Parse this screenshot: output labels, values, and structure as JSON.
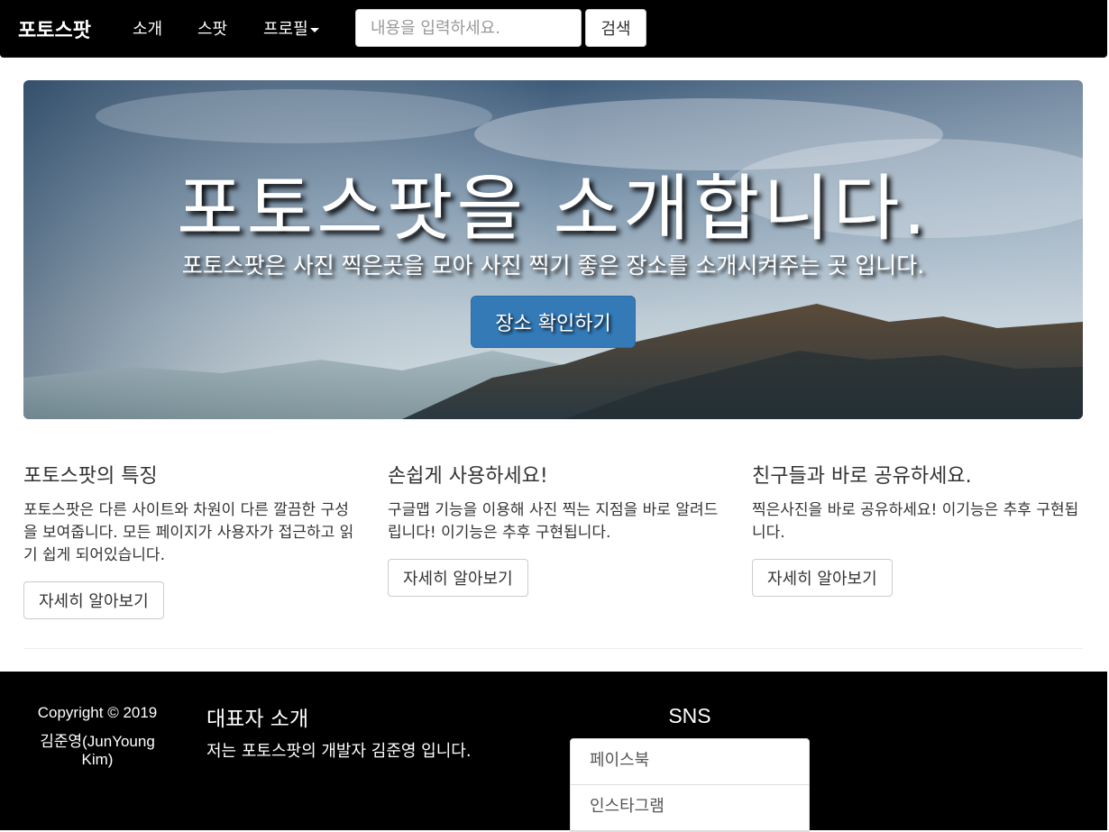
{
  "navbar": {
    "brand": "포토스팟",
    "items": [
      {
        "label": "소개"
      },
      {
        "label": "스팟"
      },
      {
        "label": "프로필"
      }
    ],
    "search": {
      "placeholder": "내용을 입력하세요.",
      "value": ""
    },
    "search_button": "검색"
  },
  "jumbotron": {
    "title": "포토스팟을 소개합니다.",
    "subtitle": "포토스팟은 사진 찍은곳을 모아 사진 찍기 좋은 장소를 소개시켜주는 곳 입니다.",
    "button": "장소 확인하기"
  },
  "features": [
    {
      "title": "포토스팟의 특징",
      "text": "포토스팟은 다른 사이트와 차원이 다른 깔끔한 구성을 보여줍니다. 모든 페이지가 사용자가 접근하고 읽기 쉽게 되어있습니다.",
      "button": "자세히 알아보기"
    },
    {
      "title": "손쉽게 사용하세요!",
      "text": "구글맵 기능을 이용해 사진 찍는 지점을 바로 알려드립니다! 이기능은 추후 구현됩니다.",
      "button": "자세히 알아보기"
    },
    {
      "title": "친구들과 바로 공유하세요.",
      "text": "찍은사진을 바로 공유하세요! 이기능은 추후 구현됩니다.",
      "button": "자세히 알아보기"
    }
  ],
  "footer": {
    "copyright": "Copyright © 2019",
    "author": "김준영(JunYoung Kim)",
    "rep_title": "대표자 소개",
    "rep_text": "저는 포토스팟의 개발자 김준영 입니다.",
    "sns_title": "SNS",
    "sns_items": [
      {
        "label": "페이스북"
      },
      {
        "label": "인스타그램"
      }
    ]
  },
  "colors": {
    "navbar_bg": "#000000",
    "primary": "#337ab7",
    "footer_bg": "#000000"
  }
}
